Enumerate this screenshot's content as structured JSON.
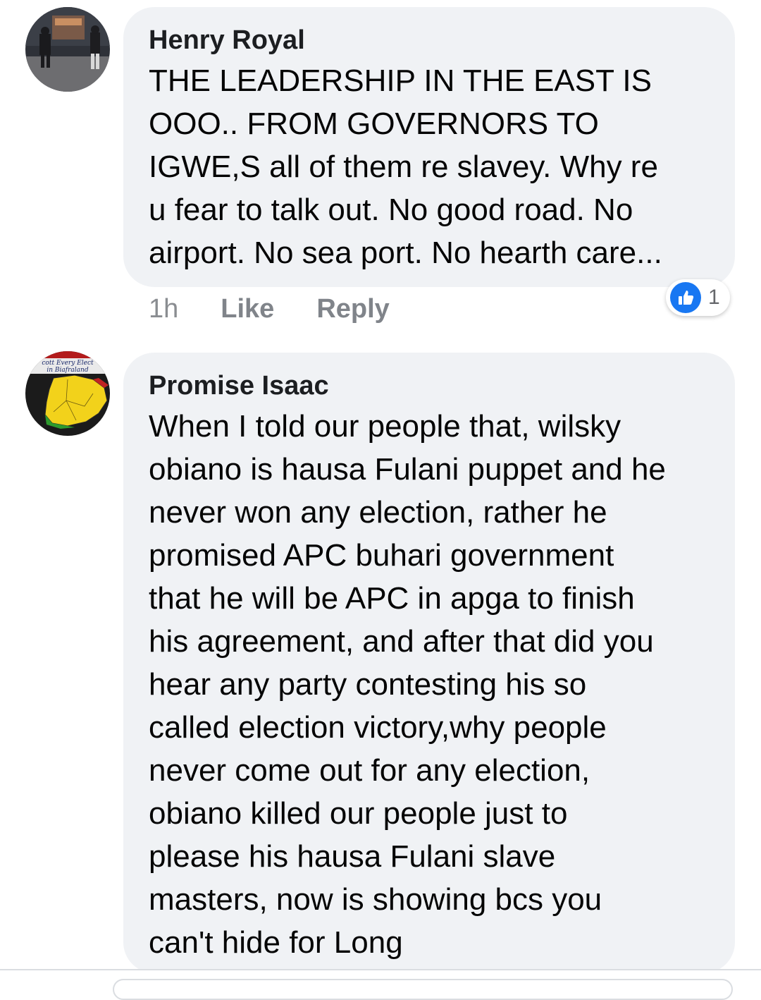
{
  "comments": [
    {
      "author": "Henry Royal",
      "avatar": "person-photo-avatar",
      "lines": [
        "THE LEADERSHIP IN THE EAST IS",
        "OOO..  FROM GOVERNORS TO",
        "IGWE,S all of  them  re slavey. Why re",
        "u fear to talk out. No good road. No",
        "airport. No sea port. No hearth care..."
      ],
      "time": "1h",
      "like_label": "Like",
      "reply_label": "Reply",
      "reaction_count": "1"
    },
    {
      "author": "Promise Isaac",
      "avatar": "biafra-map-avatar",
      "avatar_text": [
        "cott Every Elect",
        "in Biafraland"
      ],
      "lines": [
        "When I told our people that, wilsky",
        "obiano is hausa Fulani puppet and he",
        "never won any election, rather he",
        "promised APC buhari government",
        "that he will be APC in apga to finish",
        "his agreement, and after that did you",
        "hear any party contesting his so",
        "called election victory,why people",
        "never come out for any election,",
        "obiano killed our people just to",
        "please his hausa Fulani slave",
        "masters, now is showing bcs you",
        "can't hide for Long"
      ]
    }
  ],
  "colors": {
    "bubble": "#f0f2f5",
    "like_blue": "#1877f2",
    "meta_gray": "#8a8d91"
  }
}
